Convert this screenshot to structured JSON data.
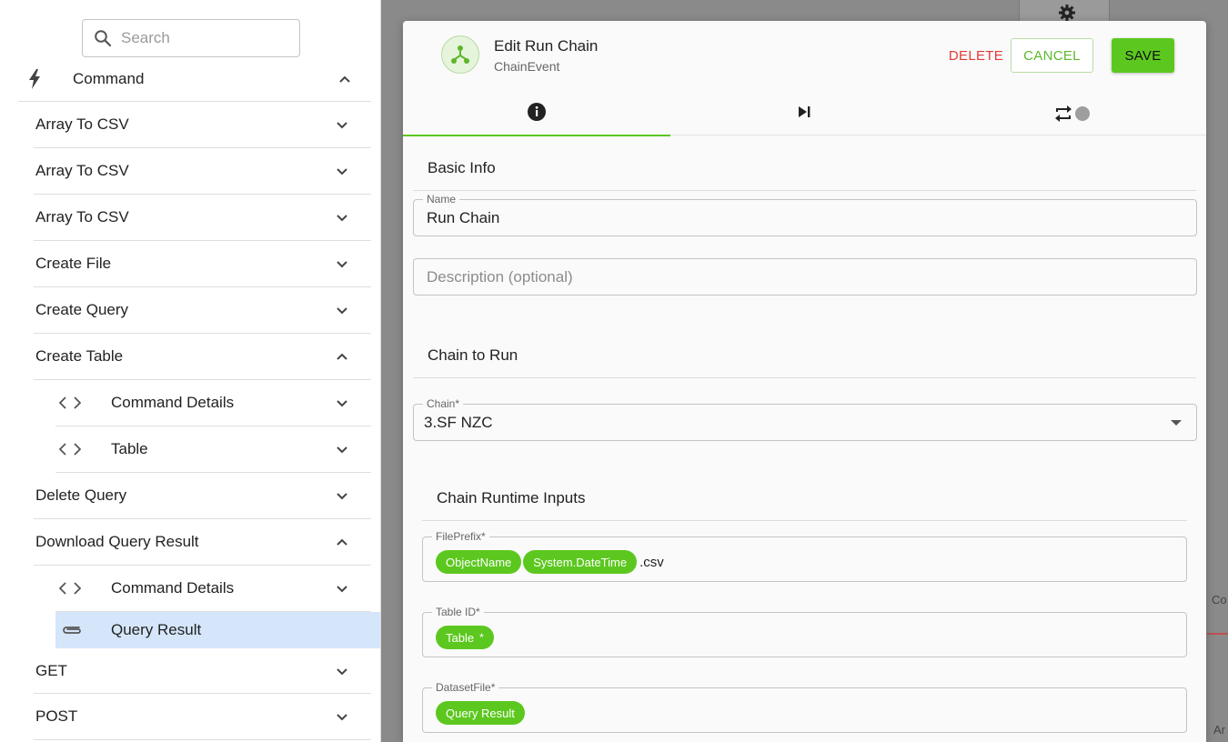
{
  "search": {
    "placeholder": "Search"
  },
  "sidebar": {
    "header": "Command",
    "items": [
      {
        "label": "Array To CSV",
        "expanded": false
      },
      {
        "label": "Array To CSV",
        "expanded": false
      },
      {
        "label": "Array To CSV",
        "expanded": false
      },
      {
        "label": "Create File",
        "expanded": false
      },
      {
        "label": "Create Query",
        "expanded": false
      },
      {
        "label": "Create Table",
        "expanded": true
      },
      {
        "label": "Command Details",
        "sub": true,
        "expanded": false
      },
      {
        "label": "Table",
        "sub": true,
        "expanded": false
      },
      {
        "label": "Delete Query",
        "expanded": false
      },
      {
        "label": "Download Query Result",
        "expanded": true
      },
      {
        "label": "Command Details",
        "sub": true,
        "expanded": false
      },
      {
        "label": "Query Result",
        "sub": true,
        "selected": true
      },
      {
        "label": "GET",
        "expanded": false
      },
      {
        "label": "POST",
        "expanded": false
      }
    ]
  },
  "dialog": {
    "title": "Edit Run Chain",
    "subtitle": "ChainEvent",
    "delete_label": "DELETE",
    "cancel_label": "CANCEL",
    "save_label": "SAVE",
    "tabs": [
      {
        "icon": "info-icon",
        "active": true
      },
      {
        "icon": "skip-next-icon",
        "active": false
      },
      {
        "icon": "repeat-toggle-icon",
        "active": false
      }
    ],
    "basic_info": {
      "title": "Basic Info",
      "name_label": "Name",
      "name_value": "Run Chain",
      "description_placeholder": "Description (optional)"
    },
    "chain_to_run": {
      "title": "Chain to Run",
      "chain_label": "Chain*",
      "chain_value": "3.SF NZC"
    },
    "runtime_inputs": {
      "title": "Chain Runtime Inputs",
      "file_prefix": {
        "label": "FilePrefix*",
        "chips": [
          "ObjectName",
          "System.DateTime"
        ],
        "suffix": ".csv"
      },
      "table_id": {
        "label": "Table ID*",
        "chip": "Table",
        "star": "*"
      },
      "dataset_file": {
        "label": "DatasetFile*",
        "chip": "Query Result"
      }
    }
  },
  "canvas": {
    "partial_label_right": "Co",
    "partial_label_bottom": "Ar"
  },
  "colors": {
    "accent": "#5cc81f",
    "danger": "#e53935",
    "selected_row": "#d5e6fb"
  }
}
